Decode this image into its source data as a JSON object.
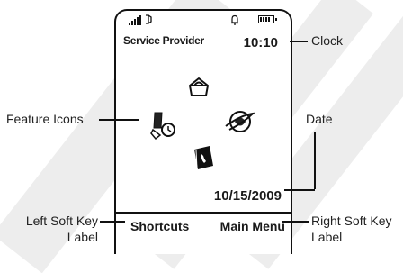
{
  "phone": {
    "provider": "Service Provider",
    "clock": "10:10",
    "date": "10/15/2009",
    "left_softkey": "Shortcuts",
    "right_softkey": "Main Menu",
    "status_icons": [
      "signal-strength-icon",
      "phone-status-icon",
      "alert-icon",
      "battery-icon"
    ],
    "feature_icons": [
      "shopping-bag-icon",
      "tools-icon",
      "web-browser-icon",
      "phonebook-icon"
    ]
  },
  "callouts": {
    "clock": "Clock",
    "feature_icons": "Feature Icons",
    "date": "Date",
    "left_softkey_line1": "Left Soft Key",
    "left_softkey_line2": "Label",
    "right_softkey_line1": "Right Soft Key",
    "right_softkey_line2": "Label"
  }
}
